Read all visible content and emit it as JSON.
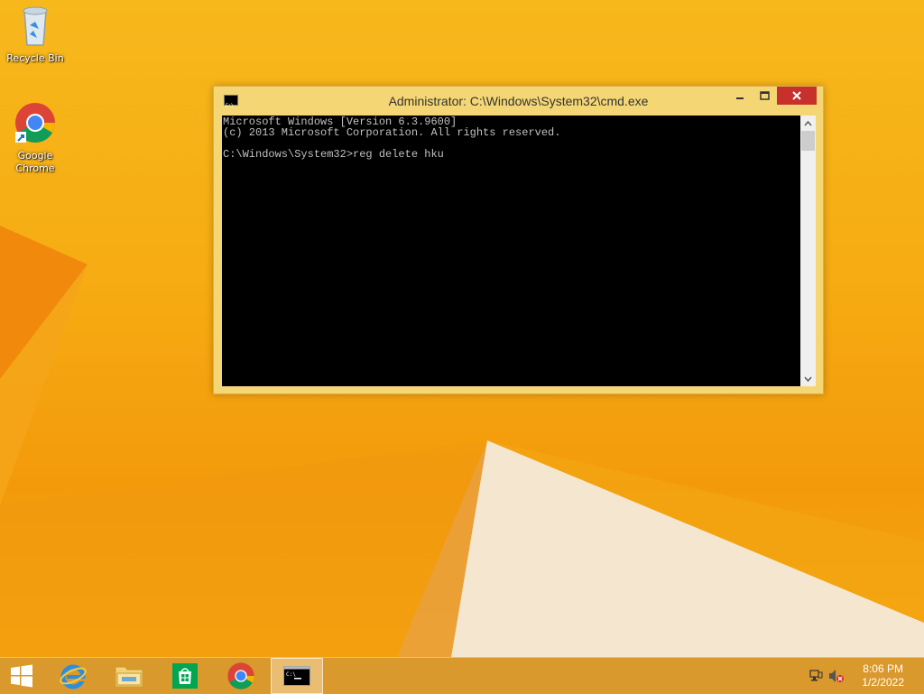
{
  "desktop": {
    "icons": [
      {
        "label": "Recycle Bin",
        "icon": "recycle-bin-icon"
      },
      {
        "label": "Google Chrome",
        "icon": "chrome-icon"
      }
    ]
  },
  "window": {
    "title": "Administrator: C:\\Windows\\System32\\cmd.exe",
    "icon": "cmd-icon",
    "controls": {
      "minimize": "–",
      "maximize": "□",
      "close": "✕"
    },
    "console_text": "Microsoft Windows [Version 6.3.9600]\n(c) 2013 Microsoft Corporation. All rights reserved.\n\nC:\\Windows\\System32>reg delete hku",
    "scroll_up": "˄",
    "scroll_down": "˅"
  },
  "taskbar": {
    "items": [
      {
        "name": "start-icon"
      },
      {
        "name": "internet-explorer-icon"
      },
      {
        "name": "file-explorer-icon"
      },
      {
        "name": "store-icon"
      },
      {
        "name": "chrome-icon"
      },
      {
        "name": "cmd-icon",
        "active": true
      }
    ],
    "tray": {
      "network_icon": "network-icon",
      "volume_icon": "volume-muted-icon"
    },
    "clock": {
      "time": "8:06 PM",
      "date": "1/2/2022"
    }
  },
  "colors": {
    "wallpaper": "#f6ac12",
    "window_frame": "#f5d675",
    "close_button": "#c7302b",
    "console_bg": "#000000",
    "console_text": "#c0c0c0"
  }
}
